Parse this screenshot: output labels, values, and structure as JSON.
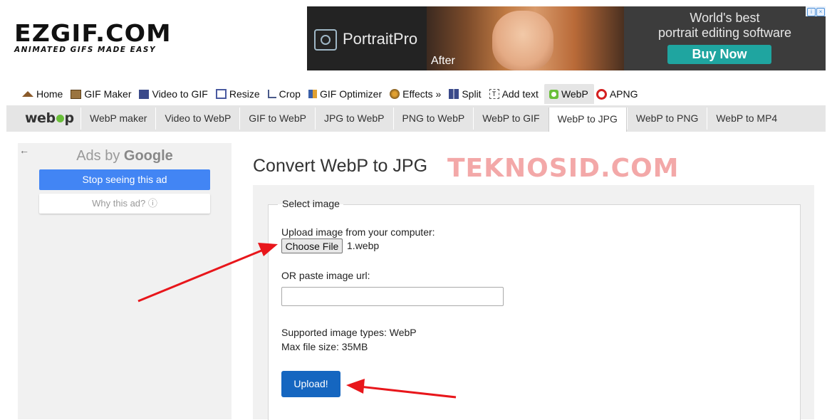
{
  "header": {
    "logo_main": "EZGIF.COM",
    "logo_tagline": "ANIMATED GIFS MADE EASY"
  },
  "ad_banner": {
    "brand": "PortraitPro",
    "photo_caption": "After",
    "headline_line1": "World's best",
    "headline_line2": "portrait editing software",
    "cta": "Buy Now"
  },
  "main_nav": {
    "items": [
      {
        "label": "Home",
        "icon": "home-icon"
      },
      {
        "label": "GIF Maker",
        "icon": "gif-maker-icon"
      },
      {
        "label": "Video to GIF",
        "icon": "film-icon"
      },
      {
        "label": "Resize",
        "icon": "resize-icon"
      },
      {
        "label": "Crop",
        "icon": "crop-icon"
      },
      {
        "label": "GIF Optimizer",
        "icon": "optimizer-icon"
      },
      {
        "label": "Effects »",
        "icon": "effects-icon"
      },
      {
        "label": "Split",
        "icon": "split-icon"
      },
      {
        "label": "Add text",
        "icon": "add-text-icon"
      },
      {
        "label": "WebP",
        "icon": "webp-icon",
        "active": true
      },
      {
        "label": "APNG",
        "icon": "apng-icon"
      }
    ]
  },
  "sub_nav": {
    "logo": "webp",
    "items": [
      {
        "label": "WebP maker"
      },
      {
        "label": "Video to WebP"
      },
      {
        "label": "GIF to WebP"
      },
      {
        "label": "JPG to WebP"
      },
      {
        "label": "PNG to WebP"
      },
      {
        "label": "WebP to GIF"
      },
      {
        "label": "WebP to JPG",
        "active": true
      },
      {
        "label": "WebP to PNG"
      },
      {
        "label": "WebP to MP4"
      }
    ]
  },
  "sidebar_ad": {
    "ads_by": "Ads by",
    "google": "Google",
    "stop_button": "Stop seeing this ad",
    "why_button": "Why this ad? ⓘ"
  },
  "main": {
    "title": "Convert WebP to JPG",
    "watermark": "TEKNOSID.COM",
    "legend": "Select image",
    "upload_label": "Upload image from your computer:",
    "choose_file_button": "Choose File",
    "chosen_file": "1.webp",
    "url_label": "OR paste image url:",
    "url_value": "",
    "supported_types": "Supported image types: WebP",
    "max_size": "Max file size: 35MB",
    "upload_button": "Upload!"
  },
  "colors": {
    "upload_button": "#1566c0",
    "stop_ad_button": "#4285f4",
    "active_tab_bg": "#e5e5e5",
    "annotation_arrow": "#e8161b",
    "watermark": "#f29a9a"
  }
}
